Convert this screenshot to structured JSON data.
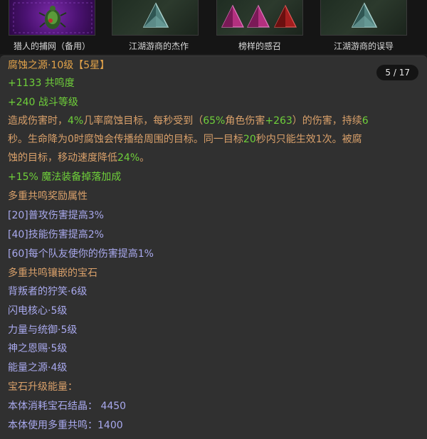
{
  "top_slots": [
    {
      "caption": "猎人的捕网（备用）",
      "icon": "beetle-icon"
    },
    {
      "caption": "江湖游商的杰作",
      "icon": "teal-triangle-gem-icon"
    },
    {
      "caption": "榜样的感召",
      "icon": "magenta-red-triangle-gems-icon"
    },
    {
      "caption": "江湖游商的误导",
      "icon": "teal-triangle-gem-icon"
    }
  ],
  "item": {
    "title": "腐蚀之源·10级【5星】",
    "page": "5 / 17",
    "resonance": "+1133 共鸣度",
    "combat_rating": "+240 战斗等级",
    "desc_1": "造成伤害时，",
    "desc_2": "4%",
    "desc_3": "几率腐蚀目标，每秒受到（",
    "desc_4": "65%",
    "desc_5": "角色伤害",
    "desc_6": "+263",
    "desc_7": "）的伤害，持续",
    "desc_8": "6",
    "desc_9": "秒。生命降为0时腐蚀会传播给周围的目标。同一目标",
    "desc_10": "20",
    "desc_11": "秒内只能生效1次。被腐",
    "desc_12": "蚀的目标，移动速度降低",
    "desc_13": "24%",
    "desc_14": "。",
    "magic_find": "+15% 魔法装备掉落加成",
    "bonus_header": "多重共鸣奖励属性",
    "bonuses": [
      "[20]普攻伤害提高3%",
      "[40]技能伤害提高2%",
      "[60]每个队友使你的伤害提高1%"
    ],
    "socketed_header": "多重共鸣镶嵌的宝石",
    "socketed": [
      "背叛者的狞笑·6级",
      "闪电核心·5级",
      "力量与统御·5级",
      "神之恩赐·5级",
      "能量之源·4级"
    ],
    "upgrade_header": "宝石升级能量：",
    "cost_crystal": "本体消耗宝石结晶： 4450",
    "cost_resonance": "本体使用多重共鸣：1400"
  },
  "colors": {
    "title": "#e3a34a",
    "green_stat": "#6fd03a",
    "orange_text": "#d9a06a",
    "blue_text": "#a9a9ee"
  }
}
